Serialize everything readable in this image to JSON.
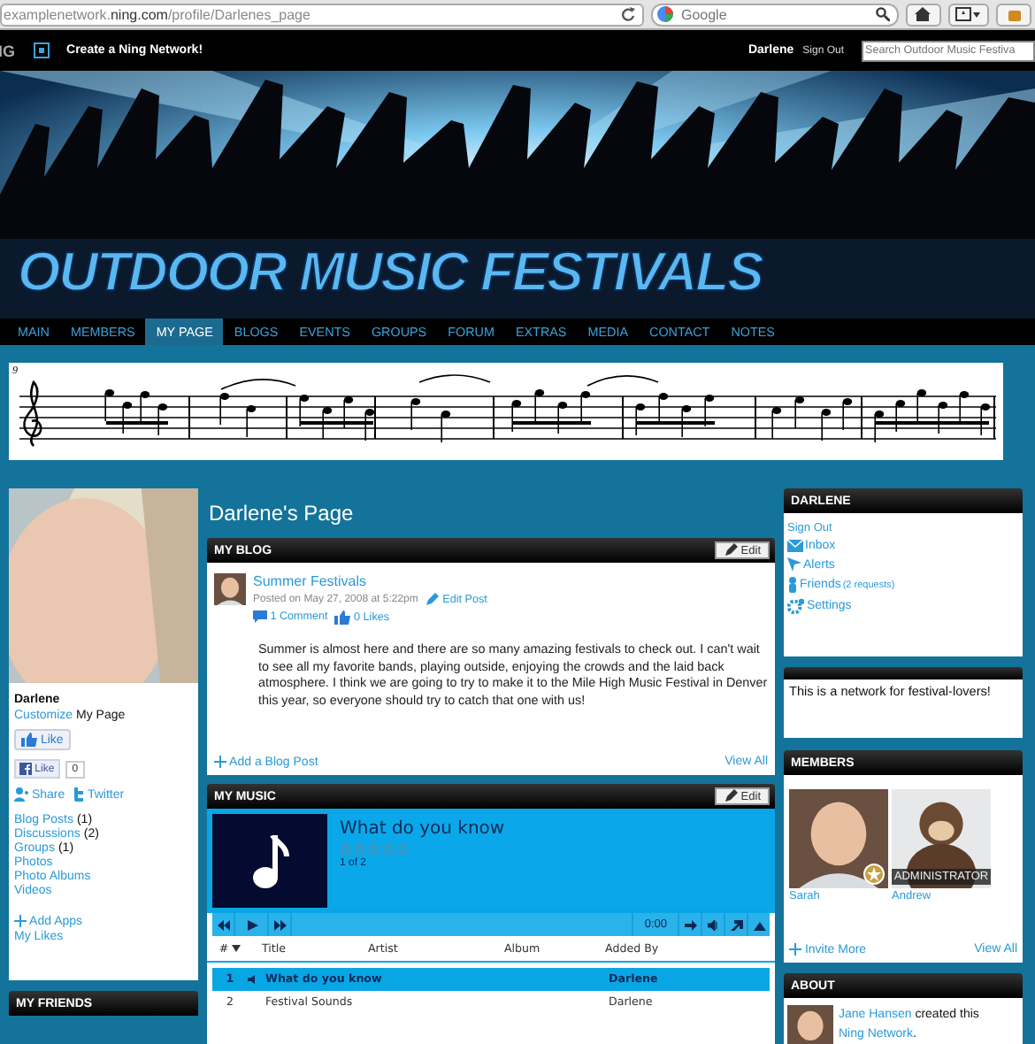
{
  "browser": {
    "url": "examplenetwork.**ning.com**/profile/Darlenes_page",
    "search_placeholder": "Google"
  },
  "topbar": {
    "logo": "IG",
    "create_link": "Create a Ning Network!",
    "user": "Darlene",
    "sign_out": "Sign Out",
    "search_placeholder": "Search Outdoor Music Festiva"
  },
  "header": {
    "title": "OUTDOOR MUSIC FESTIVALS"
  },
  "nav": [
    {
      "label": "MAIN",
      "selected": false
    },
    {
      "label": "MEMBERS",
      "selected": false
    },
    {
      "label": "MY PAGE",
      "selected": true
    },
    {
      "label": "BLOGS",
      "selected": false
    },
    {
      "label": "EVENTS",
      "selected": false
    },
    {
      "label": "GROUPS",
      "selected": false
    },
    {
      "label": "FORUM",
      "selected": false
    },
    {
      "label": "EXTRAS",
      "selected": false
    },
    {
      "label": "MEDIA",
      "selected": false
    },
    {
      "label": "CONTACT",
      "selected": false
    },
    {
      "label": "NOTES",
      "selected": false
    }
  ],
  "score": {
    "measure": "9"
  },
  "profile": {
    "name": "Darlene",
    "customize_link": "Customize",
    "customize_rest": " My Page",
    "like_button": "Like",
    "fb_like": "Like",
    "fb_count": "0",
    "share": "Share",
    "twitter": "Twitter",
    "links": [
      {
        "label": "Blog Posts",
        "count": "(1)"
      },
      {
        "label": "Discussions",
        "count": "(2)"
      },
      {
        "label": "Groups",
        "count": "(1)"
      },
      {
        "label": "Photos"
      },
      {
        "label": "Photo Albums"
      },
      {
        "label": "Videos"
      }
    ],
    "add_apps": "Add Apps",
    "my_likes": "My Likes"
  },
  "friends": {
    "title": "MY FRIENDS"
  },
  "page_title": "Darlene's Page",
  "blog": {
    "title": "MY BLOG",
    "edit": "Edit",
    "post_title": "Summer Festivals",
    "posted": "Posted on May 27, 2008 at 5:22pm",
    "edit_post": "Edit Post",
    "comments": "1 Comment",
    "likes": "0 Likes",
    "body": "Summer is almost here and there are so many amazing festivals to check out. I can't wait to see all my favorite bands, playing outside, enjoying the crowds and the laid back atmosphere. I think we are going to try to make it to the Mile High Music Festival in Denver this year, so everyone should try to catch that one with us!",
    "add": "Add a Blog Post",
    "view_all": "View All"
  },
  "music": {
    "title": "MY MUSIC",
    "edit": "Edit",
    "track_title": "What do you know",
    "stars": 0,
    "position": "1 of 2",
    "time": "0:00",
    "columns": [
      "#",
      "Title",
      "Artist",
      "Album",
      "Added By"
    ],
    "rows": [
      {
        "number": "1",
        "title": "What do you know",
        "added_by": "Darlene",
        "selected": true
      },
      {
        "number": "2",
        "title": "Festival Sounds",
        "added_by": "Darlene",
        "selected": false
      }
    ]
  },
  "account": {
    "title": "DARLENE",
    "sign_out": "Sign Out",
    "links": [
      {
        "kind": "inbox",
        "label": "Inbox"
      },
      {
        "kind": "alerts",
        "label": "Alerts"
      },
      {
        "kind": "friends",
        "label": "Friends",
        "note": "(2 requests)"
      },
      {
        "kind": "settings",
        "label": "Settings"
      }
    ]
  },
  "blurb": "This is a network for festival-lovers!",
  "members": {
    "title": "MEMBERS",
    "items": [
      {
        "name": "Sarah",
        "featured": true
      },
      {
        "name": "Andrew",
        "featured": false,
        "badge": "ADMINISTRATOR"
      }
    ],
    "invite": "Invite More",
    "view_all": "View All"
  },
  "about": {
    "title": "ABOUT",
    "creator": "Jane Hansen",
    "middle": " created this ",
    "network": "Ning Network",
    "end": "."
  }
}
